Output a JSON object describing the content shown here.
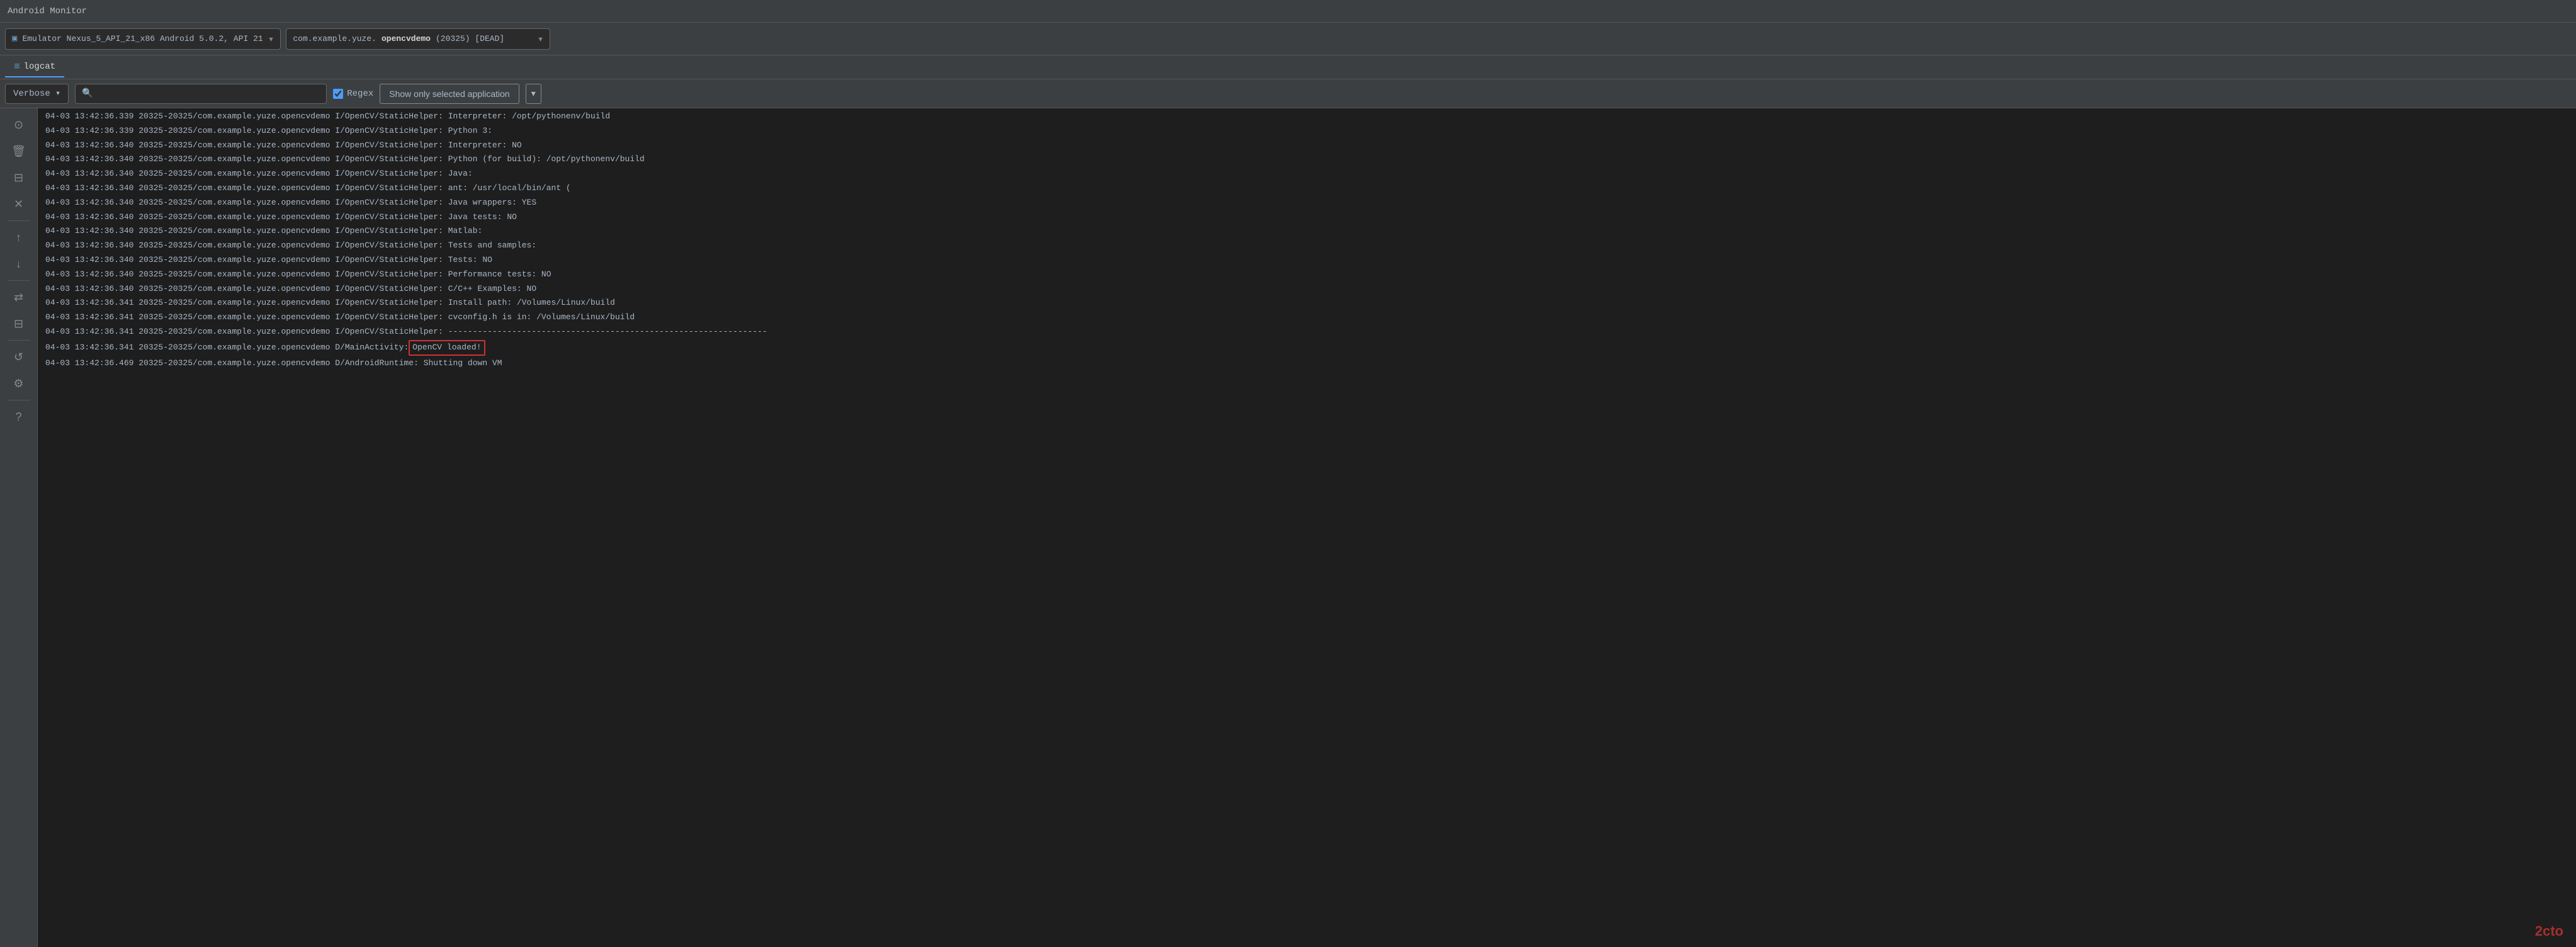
{
  "titleBar": {
    "title": "Android Monitor"
  },
  "toolbar": {
    "deviceSelector": {
      "icon": "▣",
      "label": "Emulator Nexus_5_API_21_x86 Android 5.0.2, API 21"
    },
    "appSelector": {
      "prefix": "com.example.yuze.",
      "appNameBold": "opencvdemo",
      "suffix": " (20325) [DEAD]"
    }
  },
  "logcatTab": {
    "icon": "≡",
    "label": "logcat"
  },
  "toolbar2": {
    "verbose": "Verbose",
    "searchPlaceholder": "⌕",
    "regexLabel": "Regex",
    "showSelectedLabel": "Show only selected application"
  },
  "sidebar": {
    "buttons": [
      {
        "name": "camera",
        "icon": "⊙",
        "active": false
      },
      {
        "name": "delete",
        "icon": "🗑",
        "active": false
      },
      {
        "name": "filter",
        "icon": "⊟",
        "active": false
      },
      {
        "name": "close",
        "icon": "✕",
        "active": false
      },
      {
        "name": "up",
        "icon": "↑",
        "active": false
      },
      {
        "name": "down",
        "icon": "↓",
        "active": false
      },
      {
        "name": "transfer",
        "icon": "⇄",
        "active": false
      },
      {
        "name": "print",
        "icon": "⊟",
        "active": false
      },
      {
        "name": "refresh",
        "icon": "↺",
        "active": false
      },
      {
        "name": "settings",
        "icon": "⚙",
        "active": false
      },
      {
        "name": "help",
        "icon": "?",
        "active": false
      }
    ]
  },
  "logs": [
    {
      "line": "04-03 13:42:36.339 20325-20325/com.example.yuze.opencvdemo I/OpenCV/StaticHelper:     Interpreter:                         /opt/pythonenv/build"
    },
    {
      "line": "04-03 13:42:36.339 20325-20325/com.example.yuze.opencvdemo I/OpenCV/StaticHelper:       Python 3:"
    },
    {
      "line": "04-03 13:42:36.340 20325-20325/com.example.yuze.opencvdemo I/OpenCV/StaticHelper:         Interpreter:                       NO"
    },
    {
      "line": "04-03 13:42:36.340 20325-20325/com.example.yuze.opencvdemo I/OpenCV/StaticHelper:       Python (for build):                  /opt/pythonenv/build"
    },
    {
      "line": "04-03 13:42:36.340 20325-20325/com.example.yuze.opencvdemo I/OpenCV/StaticHelper:       Java:"
    },
    {
      "line": "04-03 13:42:36.340 20325-20325/com.example.yuze.opencvdemo I/OpenCV/StaticHelper:         ant:                               /usr/local/bin/ant ("
    },
    {
      "line": "04-03 13:42:36.340 20325-20325/com.example.yuze.opencvdemo I/OpenCV/StaticHelper:         Java wrappers:                     YES"
    },
    {
      "line": "04-03 13:42:36.340 20325-20325/com.example.yuze.opencvdemo I/OpenCV/StaticHelper:         Java tests:                        NO"
    },
    {
      "line": "04-03 13:42:36.340 20325-20325/com.example.yuze.opencvdemo I/OpenCV/StaticHelper:       Matlab:"
    },
    {
      "line": "04-03 13:42:36.340 20325-20325/com.example.yuze.opencvdemo I/OpenCV/StaticHelper:       Tests and samples:"
    },
    {
      "line": "04-03 13:42:36.340 20325-20325/com.example.yuze.opencvdemo I/OpenCV/StaticHelper:         Tests:                             NO"
    },
    {
      "line": "04-03 13:42:36.340 20325-20325/com.example.yuze.opencvdemo I/OpenCV/StaticHelper:         Performance tests:                 NO"
    },
    {
      "line": "04-03 13:42:36.340 20325-20325/com.example.yuze.opencvdemo I/OpenCV/StaticHelper:         C/C++ Examples:                    NO"
    },
    {
      "line": "04-03 13:42:36.341 20325-20325/com.example.yuze.opencvdemo I/OpenCV/StaticHelper:       Install path:                        /Volumes/Linux/build"
    },
    {
      "line": "04-03 13:42:36.341 20325-20325/com.example.yuze.opencvdemo I/OpenCV/StaticHelper:       cvconfig.h is in:                    /Volumes/Linux/build"
    },
    {
      "line": "04-03 13:42:36.341 20325-20325/com.example.yuze.opencvdemo I/OpenCV/StaticHelper:       -----------------------------------------------------------------"
    },
    {
      "line": "04-03 13:42:36.341 20325-20325/com.example.yuze.opencvdemo D/MainActivity:",
      "highlight": "OpenCV loaded!",
      "suffix": ""
    },
    {
      "line": "04-03 13:42:36.469 20325-20325/com.example.yuze.opencvdemo D/AndroidRuntime: Shutting down VM"
    }
  ],
  "watermark": "2cto"
}
